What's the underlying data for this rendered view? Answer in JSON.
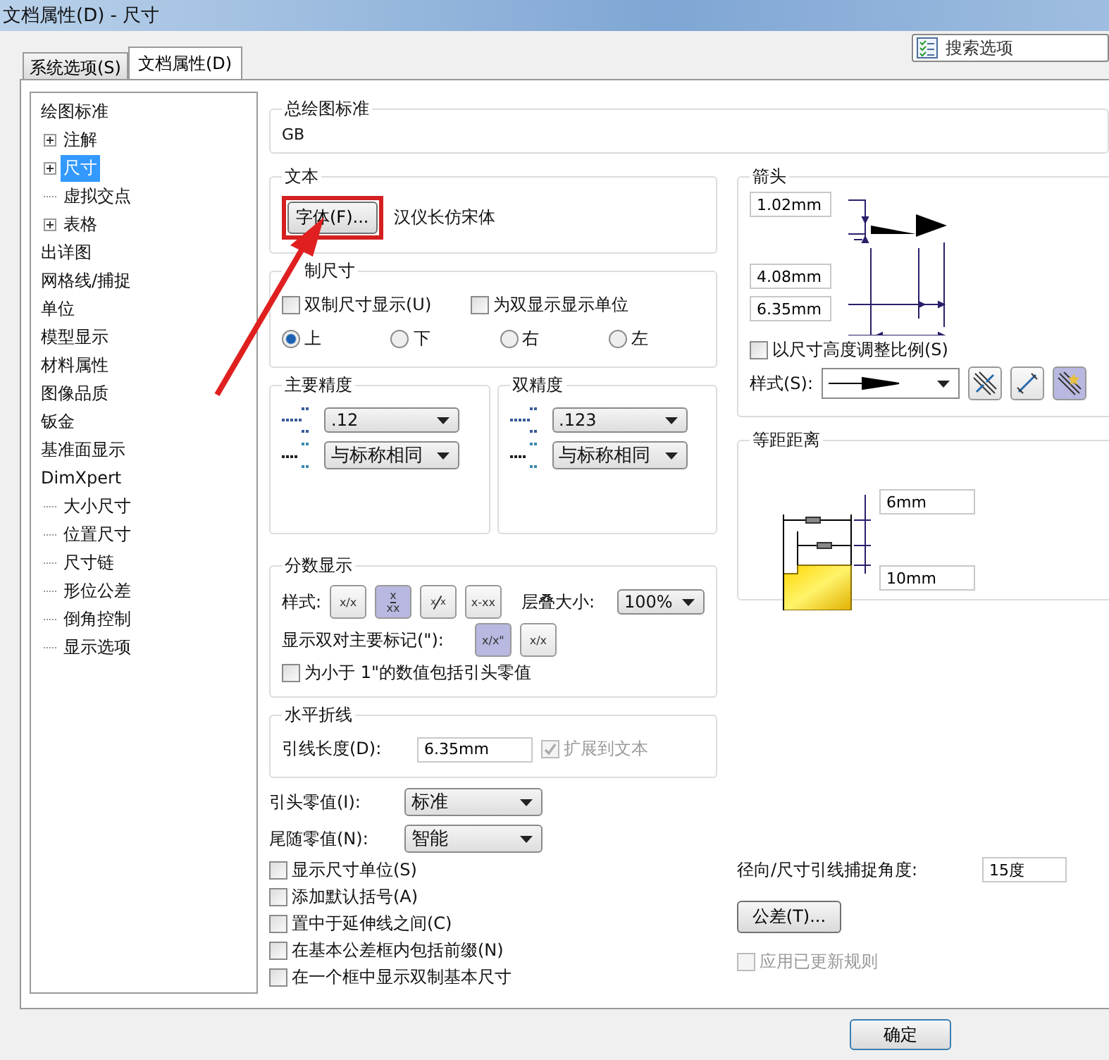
{
  "window": {
    "title": "文档属性(D) - 尺寸"
  },
  "tabs": [
    {
      "label": "系统选项(S)",
      "selected": false
    },
    {
      "label": "文档属性(D)",
      "selected": true
    }
  ],
  "search": {
    "placeholder": "搜索选项"
  },
  "tree": [
    {
      "label": "绘图标准",
      "selected": false,
      "children": [
        {
          "label": "注解",
          "expandable": true,
          "selected": false
        },
        {
          "label": "尺寸",
          "expandable": true,
          "selected": true
        },
        {
          "label": "虚拟交点",
          "expandable": false,
          "selected": false
        },
        {
          "label": "表格",
          "expandable": true,
          "selected": false
        }
      ]
    },
    {
      "label": "出详图",
      "selected": false
    },
    {
      "label": "网格线/捕捉",
      "selected": false
    },
    {
      "label": "单位",
      "selected": false
    },
    {
      "label": "模型显示",
      "selected": false
    },
    {
      "label": "材料属性",
      "selected": false
    },
    {
      "label": "图像品质",
      "selected": false
    },
    {
      "label": "钣金",
      "selected": false
    },
    {
      "label": "基准面显示",
      "selected": false
    },
    {
      "label": "DimXpert",
      "selected": false,
      "children": [
        {
          "label": "大小尺寸",
          "expandable": false,
          "selected": false
        },
        {
          "label": "位置尺寸",
          "expandable": false,
          "selected": false
        },
        {
          "label": "尺寸链",
          "expandable": false,
          "selected": false
        },
        {
          "label": "形位公差",
          "expandable": false,
          "selected": false
        },
        {
          "label": "倒角控制",
          "expandable": false,
          "selected": false
        },
        {
          "label": "显示选项",
          "expandable": false,
          "selected": false
        }
      ]
    }
  ],
  "drafting_standard": {
    "title": "总绘图标准",
    "value": "GB"
  },
  "text_group": {
    "title": "文本",
    "font_button": "字体(F)...",
    "font_name": "汉仪长仿宋体",
    "highlighted": true
  },
  "dual_dimension": {
    "title": "制尺寸",
    "options": [
      {
        "label": "双制尺寸显示(U)",
        "checked": false
      },
      {
        "label": "为双显示显示单位",
        "checked": false
      }
    ],
    "positions": [
      {
        "label": "上",
        "selected": true
      },
      {
        "label": "下",
        "selected": false
      },
      {
        "label": "右",
        "selected": false
      },
      {
        "label": "左",
        "selected": false
      }
    ]
  },
  "precision": [
    {
      "title": "主要精度",
      "value": ".12",
      "tolerance": "与标称相同"
    },
    {
      "title": "双精度",
      "value": ".123",
      "tolerance": "与标称相同"
    }
  ],
  "fraction": {
    "title": "分数显示",
    "style_label": "样式:",
    "styles": [
      {
        "kind": "inline",
        "label": "x/x",
        "selected": false
      },
      {
        "kind": "stacked",
        "top": "x",
        "bottom": "xx",
        "selected": true
      },
      {
        "kind": "diagonal",
        "top": "x",
        "bottom": "x",
        "selected": false
      },
      {
        "kind": "inline",
        "label": "x-xx",
        "selected": false
      }
    ],
    "stack_label": "层叠大小:",
    "stack_value": "100%",
    "dual_label": "显示双对主要标记(\"):",
    "dual_marks": [
      {
        "label": "x/x\"",
        "selected": true
      },
      {
        "label": "x/x",
        "selected": false
      }
    ],
    "leading_zero": {
      "label": "为小于 1\"的数值包括引头零值",
      "checked": false
    }
  },
  "leader": {
    "title": "水平折线",
    "length_label": "引线长度(D):",
    "length": "6.35mm",
    "extend": {
      "label": "扩展到文本",
      "checked": true,
      "disabled": true
    }
  },
  "zeros": [
    {
      "label": "引头零值(I):",
      "value": "标准"
    },
    {
      "label": "尾随零值(N):",
      "value": "智能"
    }
  ],
  "options": [
    {
      "label": "显示尺寸单位(S)",
      "checked": false
    },
    {
      "label": "添加默认括号(A)",
      "checked": false
    },
    {
      "label": "置中于延伸线之间(C)",
      "checked": false
    },
    {
      "label": "在基本公差框内包括前缀(N)",
      "checked": false
    },
    {
      "label": "在一个框中显示双制基本尺寸",
      "checked": false
    }
  ],
  "arrows": {
    "title": "箭头",
    "sizes": [
      "1.02mm",
      "4.08mm",
      "6.35mm"
    ],
    "scale": {
      "label": "以尺寸高度调整比例(S)",
      "checked": false
    },
    "style_label": "样式(S):",
    "placements": [
      {
        "kind": "inside",
        "selected": false
      },
      {
        "kind": "outside",
        "selected": false
      },
      {
        "kind": "smart",
        "selected": true
      }
    ]
  },
  "offset": {
    "title": "等距距离",
    "values": [
      "6mm",
      "10mm"
    ]
  },
  "snap": {
    "label": "径向/尺寸引线捕捉角度:",
    "value": "15度"
  },
  "tolerance_button": "公差(T)...",
  "apply_rules": {
    "label": "应用已更新规则",
    "checked": false,
    "disabled": true
  },
  "buttons": [
    {
      "label": "确定"
    }
  ]
}
